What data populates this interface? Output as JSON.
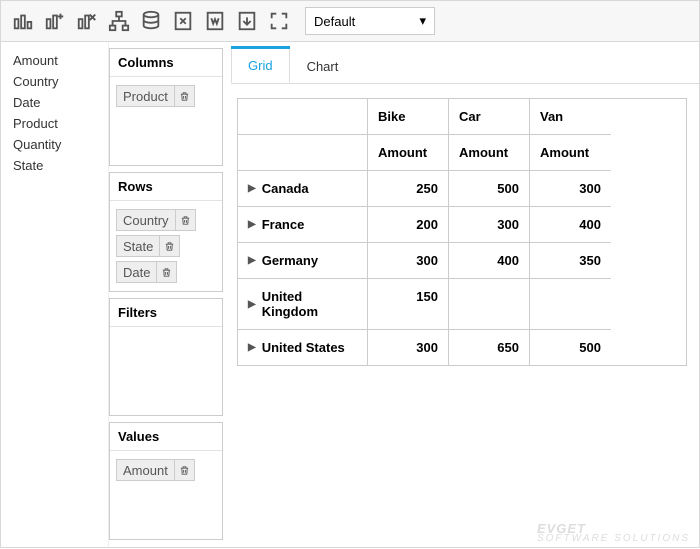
{
  "toolbar": {
    "selector_value": "Default",
    "icons": [
      "bar-chart",
      "bar-add",
      "bar-remove",
      "tree",
      "database",
      "excel-x",
      "word-w",
      "pdf",
      "fullscreen"
    ]
  },
  "fields": [
    "Amount",
    "Country",
    "Date",
    "Product",
    "Quantity",
    "State"
  ],
  "panels": {
    "columns": {
      "title": "Columns",
      "items": [
        "Product"
      ]
    },
    "rows": {
      "title": "Rows",
      "items": [
        "Country",
        "State",
        "Date"
      ]
    },
    "filters": {
      "title": "Filters",
      "items": []
    },
    "values": {
      "title": "Values",
      "items": [
        "Amount"
      ]
    }
  },
  "tabs": {
    "grid": "Grid",
    "chart": "Chart",
    "active": "grid"
  },
  "pivot": {
    "top": [
      "Bike",
      "Car",
      "Van"
    ],
    "sub": "Amount",
    "rows": [
      {
        "label": "Canada",
        "vals": [
          "250",
          "500",
          "300"
        ]
      },
      {
        "label": "France",
        "vals": [
          "200",
          "300",
          "400"
        ]
      },
      {
        "label": "Germany",
        "vals": [
          "300",
          "400",
          "350"
        ]
      },
      {
        "label": "United Kingdom",
        "vals": [
          "150",
          "",
          ""
        ]
      },
      {
        "label": "United States",
        "vals": [
          "300",
          "650",
          "500"
        ]
      }
    ]
  },
  "chart_data": {
    "type": "table",
    "row_field": "Country",
    "column_field": "Product",
    "value_field": "Amount",
    "columns": [
      "Bike",
      "Car",
      "Van"
    ],
    "rows": [
      "Canada",
      "France",
      "Germany",
      "United Kingdom",
      "United States"
    ],
    "values": [
      [
        250,
        500,
        300
      ],
      [
        200,
        300,
        400
      ],
      [
        300,
        400,
        350
      ],
      [
        150,
        null,
        null
      ],
      [
        300,
        650,
        500
      ]
    ]
  },
  "watermark": {
    "brand": "EVGET",
    "sub": "SOFTWARE SOLUTIONS"
  }
}
